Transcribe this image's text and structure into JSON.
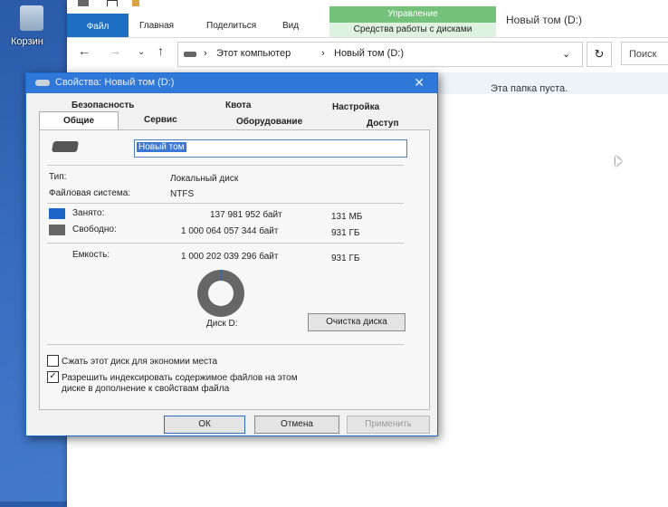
{
  "desktop": {
    "recycle_bin_label": "Корзин"
  },
  "explorer": {
    "title": "Новый том (D:)",
    "ribbon": {
      "file": "Файл",
      "home": "Главная",
      "share": "Поделиться",
      "view": "Вид",
      "manage": "Управление",
      "disk_tools": "Средства работы с дисками"
    },
    "address": {
      "path": [
        "Этот компьютер",
        "Новый том (D:)"
      ]
    },
    "search_placeholder": "Поиск",
    "empty_folder_text": "Эта папка пуста."
  },
  "dialog": {
    "title": "Свойства: Новый том (D:)",
    "tabs_row1": [
      "Безопасность",
      "Квота",
      "Настройка"
    ],
    "tabs_row2": [
      "Общие",
      "Сервис",
      "Оборудование",
      "Доступ"
    ],
    "volume_name": "Новый том",
    "type_label": "Тип:",
    "type_value": "Локальный диск",
    "fs_label": "Файловая система:",
    "fs_value": "NTFS",
    "used_label": "Занято:",
    "used_bytes": "137 981 952 байт",
    "used_short": "131 МБ",
    "free_label": "Свободно:",
    "free_bytes": "1 000 064 057 344 байт",
    "free_short": "931 ГБ",
    "capacity_label": "Емкость:",
    "capacity_bytes": "1 000 202 039 296 байт",
    "capacity_short": "931 ГБ",
    "used_fraction": 0.0001,
    "drive_label": "Диск D:",
    "cleanup_button": "Очистка диска",
    "compress_label": "Сжать этот диск для экономии места",
    "compress_checked": false,
    "index_label_1": "Разрешить индексировать содержимое файлов на этом",
    "index_label_2": "диске в дополнение к свойствам файла",
    "index_checked": true,
    "ok": "ОК",
    "cancel": "Отмена",
    "apply": "Применить",
    "colors": {
      "used": "#1e63c8",
      "free": "#666666",
      "title_bar": "#2f78d8"
    }
  }
}
